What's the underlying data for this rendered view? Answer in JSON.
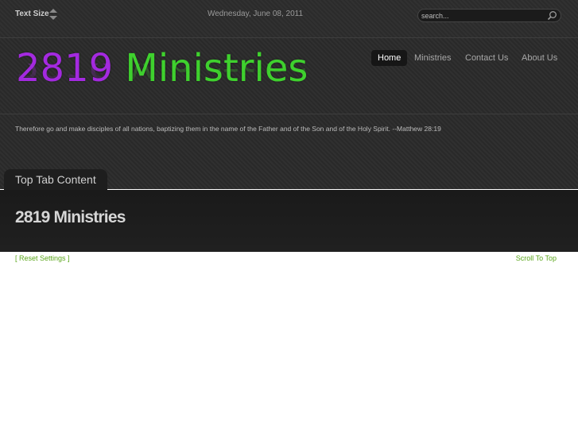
{
  "topbar": {
    "text_size_label": "Text Size",
    "date": "Wednesday, June 08, 2011",
    "search_placeholder": "search..."
  },
  "logo": {
    "number": "2819",
    "word": "Ministries"
  },
  "nav": {
    "items": [
      {
        "label": "Home",
        "active": true
      },
      {
        "label": "Ministries",
        "active": false
      },
      {
        "label": "Contact Us",
        "active": false
      },
      {
        "label": "About Us",
        "active": false
      }
    ]
  },
  "tagline": "Therefore go and make disciples of all nations, baptizing them in the name of the Father and of the Son and of the Holy Spirit. --Matthew 28:19",
  "tab": {
    "label": "Top Tab Content"
  },
  "content": {
    "title": "2819 Ministries"
  },
  "footer": {
    "reset_label": "[ Reset Settings ]",
    "scroll_label": "Scroll To Top"
  },
  "colors": {
    "logo_number": "#a42ae0",
    "logo_word": "#3fd12e",
    "link": "#5aa61a",
    "background_dark": "#2a2a2a"
  },
  "icons": [
    "text-size-arrows-icon",
    "search-icon"
  ]
}
